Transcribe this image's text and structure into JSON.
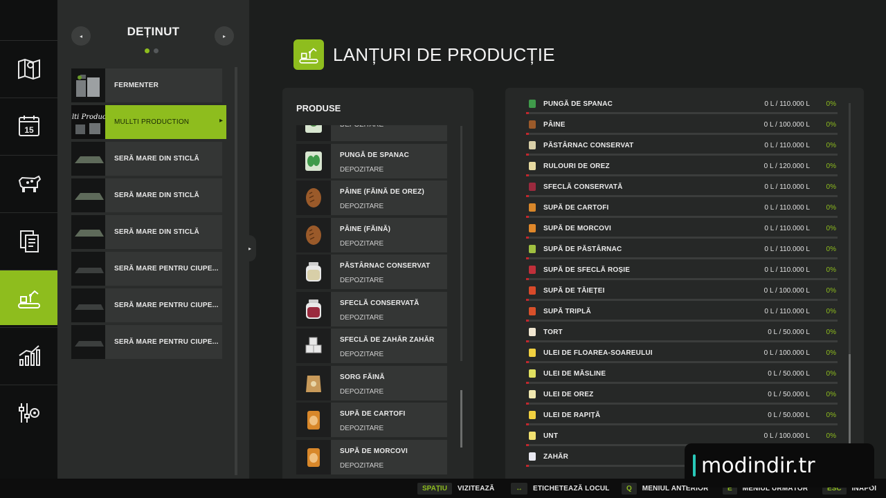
{
  "nav": [
    {
      "name": "map-icon"
    },
    {
      "name": "calendar-icon",
      "badge": "15"
    },
    {
      "name": "animals-icon"
    },
    {
      "name": "contracts-icon"
    },
    {
      "name": "production-icon",
      "active": true
    },
    {
      "name": "statistics-icon"
    },
    {
      "name": "settings-icon"
    }
  ],
  "facilities": {
    "title": "DEȚINUT",
    "prev_icon": "◂",
    "next_icon": "▸",
    "items": [
      {
        "label": "FERMENTER"
      },
      {
        "label": "MULLTI PRODUCTION",
        "thumb_text": "Multi Productio",
        "active": true
      },
      {
        "label": "SERĂ MARE DIN STICLĂ"
      },
      {
        "label": "SERĂ MARE DIN STICLĂ"
      },
      {
        "label": "SERĂ MARE DIN STICLĂ"
      },
      {
        "label": "SERĂ MARE PENTRU CIUPE..."
      },
      {
        "label": "SERĂ MARE PENTRU CIUPE..."
      },
      {
        "label": "SERĂ MARE PENTRU CIUPE..."
      }
    ]
  },
  "collapse_icon": "▸",
  "page": {
    "title": "LANȚURI DE PRODUCȚIE"
  },
  "products": {
    "heading": "PRODUSE",
    "items": [
      {
        "name": "",
        "sub": "DEPOZITARE",
        "icon": "bag-icon",
        "color": "#4f8a4a"
      },
      {
        "name": "PUNGĂ DE SPANAC",
        "sub": "DEPOZITARE",
        "icon": "spinach-icon",
        "color": "#3f9a4a"
      },
      {
        "name": "PÂINE (FĂINĂ DE OREZ)",
        "sub": "DEPOZITARE",
        "icon": "bread-icon",
        "color": "#9a5a2a"
      },
      {
        "name": "PÂINE (FĂINĂ)",
        "sub": "DEPOZITARE",
        "icon": "bread-icon",
        "color": "#9a5a2a"
      },
      {
        "name": "PĂSTÂRNAC CONSERVAT",
        "sub": "DEPOZITARE",
        "icon": "jar-icon",
        "color": "#d8cfa8"
      },
      {
        "name": "SFECLĂ CONSERVATĂ",
        "sub": "DEPOZITARE",
        "icon": "jar-icon",
        "color": "#9a2a3e"
      },
      {
        "name": "SFECLĂ DE ZAHĂR ZAHĂR",
        "sub": "DEPOZITARE",
        "icon": "sugar-cubes-icon",
        "color": "#e8e8e8"
      },
      {
        "name": "SORG FĂINĂ",
        "sub": "DEPOZITARE",
        "icon": "flour-sack-icon",
        "color": "#c89a5a"
      },
      {
        "name": "SUPĂ DE CARTOFI",
        "sub": "DEPOZITARE",
        "icon": "soup-can-icon",
        "color": "#d8872a"
      },
      {
        "name": "SUPĂ DE MORCOVI",
        "sub": "DEPOZITARE",
        "icon": "soup-can-icon",
        "color": "#d8872a"
      }
    ]
  },
  "storage": {
    "rows": [
      {
        "name": "PUNGĂ DE SPANAC",
        "value": "0 L / 110.000 L",
        "pct": "0%",
        "color": "#3f9a4a"
      },
      {
        "name": "PÂINE",
        "value": "0 L / 100.000 L",
        "pct": "0%",
        "color": "#9a5a2a"
      },
      {
        "name": "PĂSTÂRNAC CONSERVAT",
        "value": "0 L / 110.000 L",
        "pct": "0%",
        "color": "#d8cfa8"
      },
      {
        "name": "RULOURI DE OREZ",
        "value": "0 L / 120.000 L",
        "pct": "0%",
        "color": "#e6d9a0"
      },
      {
        "name": "SFECLĂ CONSERVATĂ",
        "value": "0 L / 110.000 L",
        "pct": "0%",
        "color": "#9a2a3e"
      },
      {
        "name": "SUPĂ DE CARTOFI",
        "value": "0 L / 110.000 L",
        "pct": "0%",
        "color": "#d8872a"
      },
      {
        "name": "SUPĂ DE MORCOVI",
        "value": "0 L / 110.000 L",
        "pct": "0%",
        "color": "#e0882a"
      },
      {
        "name": "SUPĂ DE PĂSTÂRNAC",
        "value": "0 L / 110.000 L",
        "pct": "0%",
        "color": "#a0c040"
      },
      {
        "name": "SUPĂ DE SFECLĂ ROȘIE",
        "value": "0 L / 110.000 L",
        "pct": "0%",
        "color": "#c0303a"
      },
      {
        "name": "SUPĂ DE TĂIEȚEI",
        "value": "0 L / 100.000 L",
        "pct": "0%",
        "color": "#d84a2a"
      },
      {
        "name": "SUPĂ TRIPLĂ",
        "value": "0 L / 110.000 L",
        "pct": "0%",
        "color": "#d8502a"
      },
      {
        "name": "TORT",
        "value": "0 L / 50.000 L",
        "pct": "0%",
        "color": "#f0e6d0"
      },
      {
        "name": "ULEI DE FLOAREA-SOAREULUI",
        "value": "0 L / 100.000 L",
        "pct": "0%",
        "color": "#f0d040"
      },
      {
        "name": "ULEI DE MĂSLINE",
        "value": "0 L / 50.000 L",
        "pct": "0%",
        "color": "#e0e060"
      },
      {
        "name": "ULEI DE OREZ",
        "value": "0 L / 50.000 L",
        "pct": "0%",
        "color": "#f0e8b0"
      },
      {
        "name": "ULEI DE RAPIȚĂ",
        "value": "0 L / 50.000 L",
        "pct": "0%",
        "color": "#f0d040"
      },
      {
        "name": "UNT",
        "value": "0 L / 100.000 L",
        "pct": "0%",
        "color": "#f0e070"
      },
      {
        "name": "ZAHĂR",
        "value": "0 L / 250.000 L",
        "pct": "0%",
        "color": "#e8e8f0"
      }
    ]
  },
  "hints": [
    {
      "key": "SPAȚIU",
      "label": "VIZITEAZĂ"
    },
    {
      "key": "↔",
      "label": "ETICHETEAZĂ LOCUL"
    },
    {
      "key": "Q",
      "label": "MENIUL ANTERIOR"
    },
    {
      "key": "E",
      "label": "MENIUL URMĂTOR"
    },
    {
      "key": "ESC",
      "label": "ÎNAPOI"
    }
  ],
  "watermark": {
    "text": "modindir.tr"
  },
  "colors": {
    "accent": "#8ebd1e",
    "bar_empty": "#c1272d"
  }
}
